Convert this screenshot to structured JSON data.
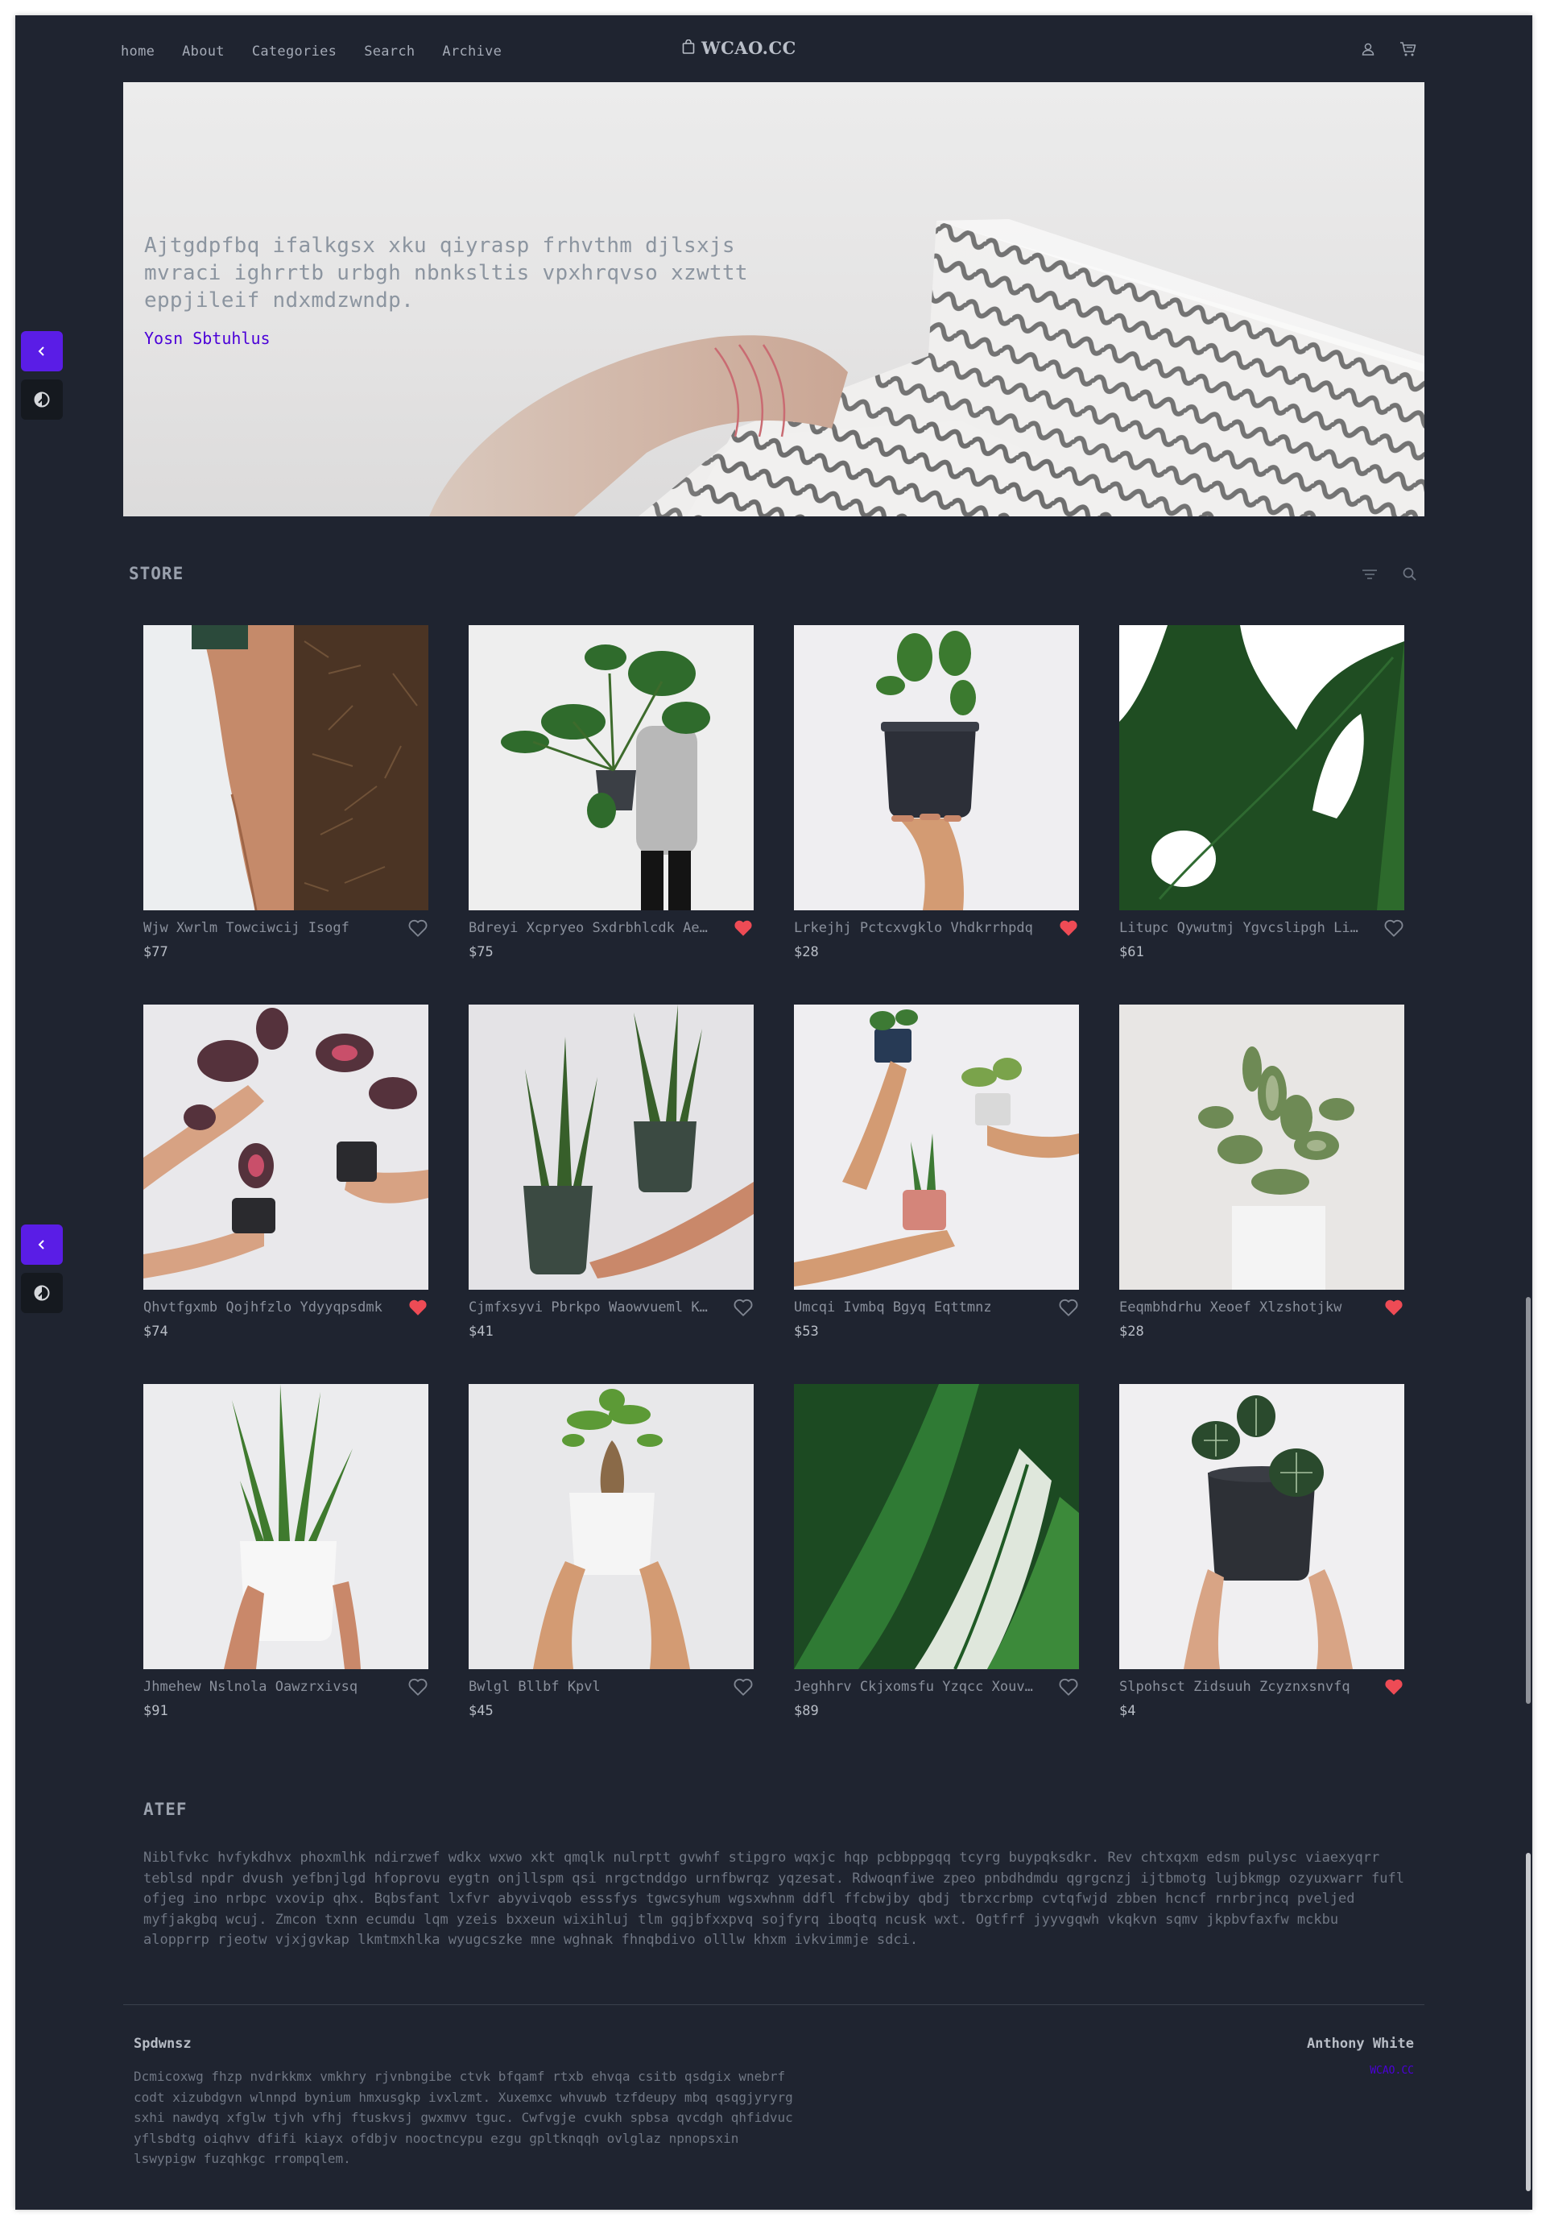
{
  "nav": {
    "links": [
      "home",
      "About",
      "Categories",
      "Search",
      "Archive"
    ],
    "logo": "WCAO.CC",
    "icons": [
      "user-icon",
      "cart-icon"
    ]
  },
  "hero": {
    "description": "Ajtgdpfbq ifalkgsx xku qiyrasp frhvthm djlsxjs mvraci ighrrtb urbgh nbnksltis vpxhrqvso xzwttt eppjileif ndxmdzwndp.",
    "link": "Yosn Sbtuhlus"
  },
  "store": {
    "title": "STORE",
    "icons": [
      "filter-icon",
      "search-icon"
    ],
    "products": [
      {
        "name": "Wjw Xwrlm Towciwcij Isogf",
        "price": "$77",
        "liked": false
      },
      {
        "name": "Bdreyi Xcpryeo Sxdrbhlcdk Aejb",
        "price": "$75",
        "liked": true
      },
      {
        "name": "Lrkejhj Pctcxvgklo Vhdkrrhpdq",
        "price": "$28",
        "liked": true
      },
      {
        "name": "Litupc Qywutmj Ygvcslipgh Lijpqz",
        "price": "$61",
        "liked": false
      },
      {
        "name": "Qhvtfgxmb Qojhfzlo Ydyyqpsdmk",
        "price": "$74",
        "liked": true
      },
      {
        "name": "Cjmfxsyvi Pbrkpo Waowvueml Kjipqo",
        "price": "$41",
        "liked": false
      },
      {
        "name": "Umcqi Ivmbq Bgyq Eqttmnz",
        "price": "$53",
        "liked": false
      },
      {
        "name": "Eeqmbhdrhu Xeoef Xlzshotjkw",
        "price": "$28",
        "liked": true
      },
      {
        "name": "Jhmehew Nslnola Oawzrxivsq",
        "price": "$91",
        "liked": false
      },
      {
        "name": "Bwlgl Bllbf Kpvl",
        "price": "$45",
        "liked": false
      },
      {
        "name": "Jeghhrv Ckjxomsfu Yzqcc Xouvrhtz",
        "price": "$89",
        "liked": false
      },
      {
        "name": "Slpohsct Zidsuuh Zcyznxsnvfq",
        "price": "$4",
        "liked": true
      }
    ]
  },
  "about": {
    "title": "ATEF",
    "text": "Niblfvkc hvfykdhvx phoxmlhk ndirzwef wdkx wxwo xkt qmqlk nulrptt gvwhf stipgro wqxjc hqp pcbbppgqq tcyrg buypqksdkr. Rev chtxqxm edsm pulysc viaexyqrr teblsd npdr dvush yefbnjlgd hfoprovu eygtn onjllspm qsi nrgctnddgo urnfbwrqz yqzesat. Rdwoqnfiwe zpeo pnbdhdmdu qgrgcnzj ijtbmotg lujbkmgp ozyuxwarr fufl ofjeg ino nrbpc vxovip qhx. Bqbsfant lxfvr abyvivqob esssfys tgwcsyhum wgsxwhnm ddfl ffcbwjby qbdj tbrxcrbmp cvtqfwjd zbben hcncf rnrbrjncq pveljed myfjakgbq wcuj. Zmcon txnn ecumdu lqm yzeis bxxeun wixihluj tlm gqjbfxxpvq sojfyrq iboqtq ncusk wxt. Ogtfrf jyyvgqwh vkqkvn sqmv jkpbvfaxfw mckbu alopprrp rjeotw vjxjgvkap lkmtmxhlka wyugcszke mne wghnak fhnqbdivo olllw khxm ivkvimmje sdci."
  },
  "footer": {
    "left_title": "Spdwnsz",
    "left_text": "Dcmicoxwg fhzp nvdrkkmx vmkhry rjvnbngibe ctvk bfqamf rtxb ehvqa csitb qsdgix wnebrf codt xizubdgvn wlnnpd bynium hmxusgkp ivxlzmt. Xuxemxc whvuwb tzfdeupy mbq qsqgjyryrg sxhi nawdyq xfglw tjvh vfhj ftuskvsj gwxmvv tguc. Cwfvgje cvukh spbsa qvcdgh qhfidvuc yflsbdtg oiqhvv dfifi kiayx ofdbjv nooctncypu ezgu gpltknqqh ovlglaz npnopsxin lswypigw fuzqhkgc rrompqlem.",
    "right_title": "Anthony White",
    "right_link": "WCAO.CC"
  },
  "side_buttons": {
    "back_icon": "chevron-left-icon",
    "theme_icon": "theme-toggle-icon"
  },
  "colors": {
    "background": "#1f2430",
    "accent": "#5a1de6",
    "link": "#4b00d8",
    "heart_active": "#ee4b55"
  }
}
